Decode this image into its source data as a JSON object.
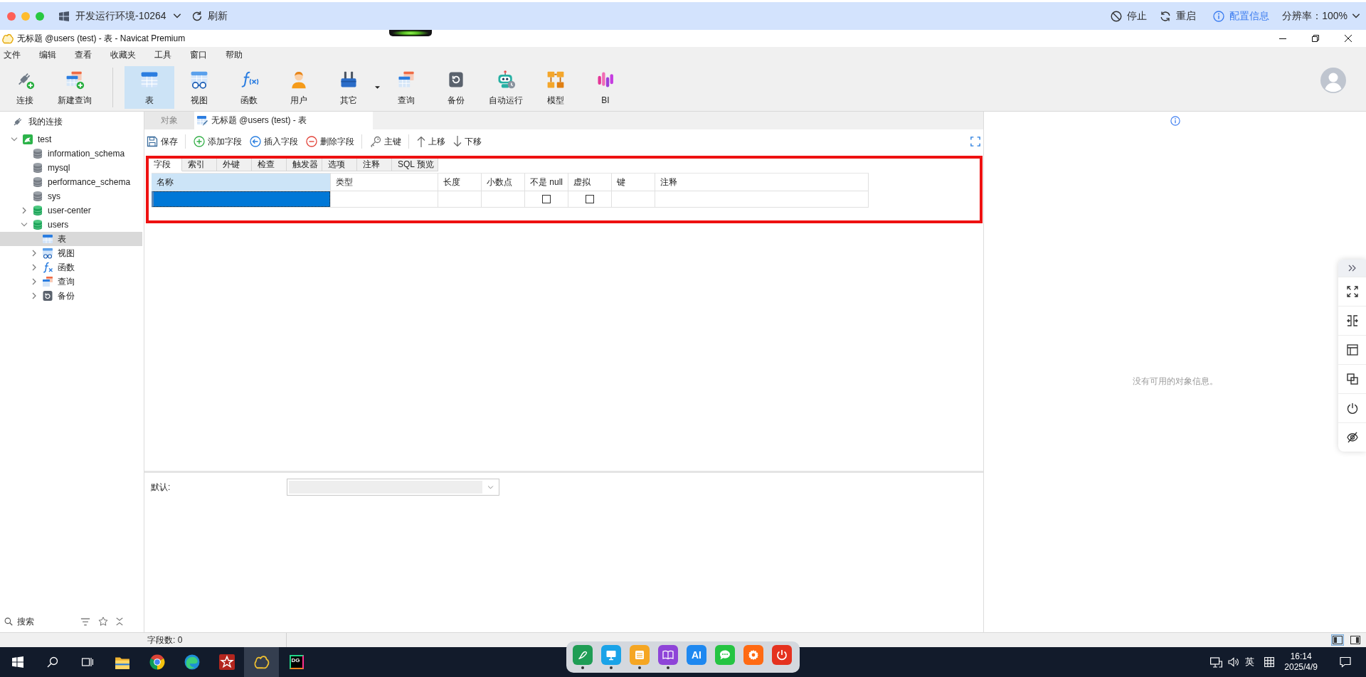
{
  "remote_bar": {
    "environment": "开发运行环境-10264",
    "refresh": "刷新",
    "actions": [
      {
        "kind": "stop",
        "label": "停止"
      },
      {
        "kind": "restart",
        "label": "重启"
      },
      {
        "kind": "info",
        "label": "配置信息"
      }
    ],
    "resolution": "分辨率：100%"
  },
  "window": {
    "title": "无标题 @users (test) - 表 - Navicat Premium"
  },
  "menu": [
    "文件",
    "编辑",
    "查看",
    "收藏夹",
    "工具",
    "窗口",
    "帮助"
  ],
  "toolbar": {
    "groups": [
      {
        "items": [
          {
            "kind": "connect",
            "label": "连接",
            "selected": false,
            "dropdown": false
          },
          {
            "kind": "new-query",
            "label": "新建查询",
            "selected": false,
            "dropdown": false
          }
        ]
      },
      {
        "items": [
          {
            "kind": "table",
            "label": "表",
            "selected": true,
            "dropdown": false
          },
          {
            "kind": "view",
            "label": "视图",
            "selected": false,
            "dropdown": false
          },
          {
            "kind": "function",
            "label": "函数",
            "selected": false,
            "dropdown": false
          },
          {
            "kind": "user",
            "label": "用户",
            "selected": false,
            "dropdown": false
          },
          {
            "kind": "other",
            "label": "其它",
            "selected": false,
            "dropdown": true
          },
          {
            "kind": "query",
            "label": "查询",
            "selected": false,
            "dropdown": false
          },
          {
            "kind": "backup",
            "label": "备份",
            "selected": false,
            "dropdown": false
          },
          {
            "kind": "automation",
            "label": "自动运行",
            "selected": false,
            "dropdown": false
          },
          {
            "kind": "model",
            "label": "模型",
            "selected": false,
            "dropdown": false
          },
          {
            "kind": "bi",
            "label": "BI",
            "selected": false,
            "dropdown": false
          }
        ]
      }
    ]
  },
  "sidebar": {
    "tree": [
      {
        "kind": "group",
        "label": "我的连接",
        "selected": false,
        "children": [
          {
            "kind": "connection",
            "label": "test",
            "selected": false,
            "expanded": true,
            "children": [
              {
                "kind": "database",
                "label": "information_schema",
                "selected": false,
                "open": false
              },
              {
                "kind": "database",
                "label": "mysql",
                "selected": false,
                "open": false
              },
              {
                "kind": "database",
                "label": "performance_schema",
                "selected": false,
                "open": false
              },
              {
                "kind": "database",
                "label": "sys",
                "selected": false,
                "open": false
              },
              {
                "kind": "database",
                "label": "user-center",
                "selected": false,
                "open": true,
                "expanded": false
              },
              {
                "kind": "database",
                "label": "users",
                "selected": false,
                "open": true,
                "expanded": true,
                "children": [
                  {
                    "kind": "tables",
                    "label": "表",
                    "selected": true
                  },
                  {
                    "kind": "views",
                    "label": "视图",
                    "selected": false,
                    "expanded": false
                  },
                  {
                    "kind": "functions",
                    "label": "函数",
                    "selected": false,
                    "expanded": false
                  },
                  {
                    "kind": "queries",
                    "label": "查询",
                    "selected": false,
                    "expanded": false
                  },
                  {
                    "kind": "backups",
                    "label": "备份",
                    "selected": false,
                    "expanded": false
                  }
                ]
              }
            ]
          }
        ]
      }
    ],
    "search": {
      "placeholder": "搜索"
    }
  },
  "editor": {
    "tabs": [
      {
        "kind": "objects",
        "label": "对象",
        "selected": false
      },
      {
        "kind": "table-design",
        "label": "无标题 @users (test) - 表",
        "selected": true
      }
    ],
    "action_groups": [
      {
        "items": [
          {
            "kind": "save",
            "label": "保存"
          }
        ]
      },
      {
        "items": [
          {
            "kind": "add",
            "label": "添加字段"
          },
          {
            "kind": "insert",
            "label": "插入字段"
          },
          {
            "kind": "delete",
            "label": "删除字段"
          }
        ]
      },
      {
        "items": [
          {
            "kind": "key",
            "label": "主键"
          }
        ]
      },
      {
        "items": [
          {
            "kind": "up",
            "label": "上移"
          },
          {
            "kind": "down",
            "label": "下移"
          }
        ]
      }
    ],
    "field_tabs": [
      {
        "label": "字段",
        "selected": true
      },
      {
        "label": "索引",
        "selected": false
      },
      {
        "label": "外键",
        "selected": false
      },
      {
        "label": "检查",
        "selected": false
      },
      {
        "label": "触发器",
        "selected": false
      },
      {
        "label": "选项",
        "selected": false
      },
      {
        "label": "注释",
        "selected": false
      },
      {
        "label": "SQL 预览",
        "selected": false
      }
    ],
    "grid": {
      "columns": [
        {
          "label": "名称",
          "selected": true
        },
        {
          "label": "类型",
          "selected": false
        },
        {
          "label": "长度",
          "selected": false
        },
        {
          "label": "小数点",
          "selected": false
        },
        {
          "label": "不是 null",
          "selected": false
        },
        {
          "label": "虚拟",
          "selected": false
        },
        {
          "label": "键",
          "selected": false
        },
        {
          "label": "注释",
          "selected": false
        }
      ],
      "rows": [
        {
          "cells": [
            {
              "kind": "input",
              "selected": true
            },
            {
              "kind": "empty"
            },
            {
              "kind": "empty"
            },
            {
              "kind": "empty"
            },
            {
              "kind": "checkbox",
              "checked": false
            },
            {
              "kind": "checkbox",
              "checked": false
            },
            {
              "kind": "empty"
            },
            {
              "kind": "empty"
            }
          ]
        }
      ]
    },
    "highlighted": true,
    "default_field": {
      "label": "默认:",
      "disabled": true
    }
  },
  "info_panel": {
    "message": "没有可用的对象信息。"
  },
  "status_bar": {
    "text": "字段数: 0",
    "panes": [
      {
        "kind": "left",
        "selected": true
      },
      {
        "kind": "right",
        "selected": false
      }
    ]
  },
  "taskbar": {
    "apps": [
      {
        "kind": "start",
        "selected": false
      },
      {
        "kind": "search",
        "selected": false
      },
      {
        "kind": "task-view",
        "selected": false
      },
      {
        "kind": "explorer",
        "selected": false
      },
      {
        "kind": "chrome",
        "selected": false
      },
      {
        "kind": "edge",
        "selected": false
      },
      {
        "kind": "star-app",
        "selected": false
      },
      {
        "kind": "navicat",
        "selected": true
      },
      {
        "kind": "datagrip",
        "label": "DG",
        "selected": false
      }
    ],
    "dock": [
      {
        "kind": "pen",
        "running": true
      },
      {
        "kind": "monitor",
        "running": true
      },
      {
        "kind": "list",
        "running": true
      },
      {
        "kind": "book",
        "running": true
      },
      {
        "kind": "ai",
        "label": "AI",
        "running": false
      },
      {
        "kind": "chat",
        "running": false
      },
      {
        "kind": "gear",
        "running": false
      },
      {
        "kind": "power",
        "running": false
      }
    ],
    "tray": {
      "language": "英",
      "time": "16:14",
      "date": "2025/4/9"
    }
  }
}
